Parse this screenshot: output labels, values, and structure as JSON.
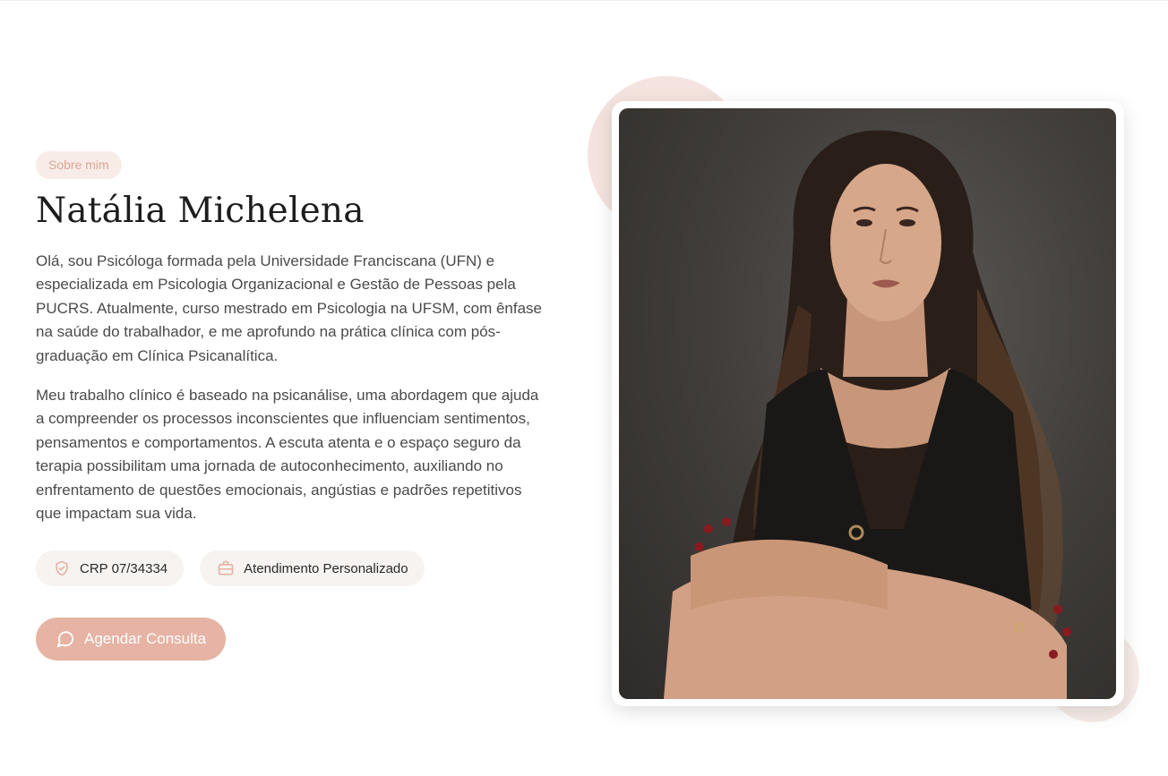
{
  "about": {
    "badge": "Sobre mim",
    "name": "Natália Michelena",
    "paragraph1": "Olá, sou Psicóloga formada pela Universidade Franciscana (UFN) e especializada em Psicologia Organizacional e Gestão de Pessoas pela PUCRS. Atualmente, curso mestrado em Psicologia na UFSM, com ênfase na saúde do trabalhador, e me aprofundo na prática clínica com pós-graduação em Clínica Psicanalítica.",
    "paragraph2": "Meu trabalho clínico é baseado na psicanálise, uma abordagem que ajuda a compreender os processos inconscientes que influenciam sentimentos, pensamentos e comportamentos. A escuta atenta e o espaço seguro da terapia possibilitam uma jornada de autoconhecimento, auxiliando no enfrentamento de questões emocionais, angústias e padrões repetitivos que impactam sua vida.",
    "chips": [
      {
        "icon": "shield-check-icon",
        "label": "CRP 07/34334"
      },
      {
        "icon": "briefcase-icon",
        "label": "Atendimento Personalizado"
      }
    ],
    "cta": {
      "icon": "chat-bubble-icon",
      "label": "Agendar Consulta"
    }
  },
  "colors": {
    "accent": "#e6b3a4",
    "badge_bg": "#f8ece8",
    "badge_text": "#dba596",
    "chip_bg": "#f6f3f1",
    "text": "#4a4a4a",
    "heading": "#1d1d1d"
  }
}
